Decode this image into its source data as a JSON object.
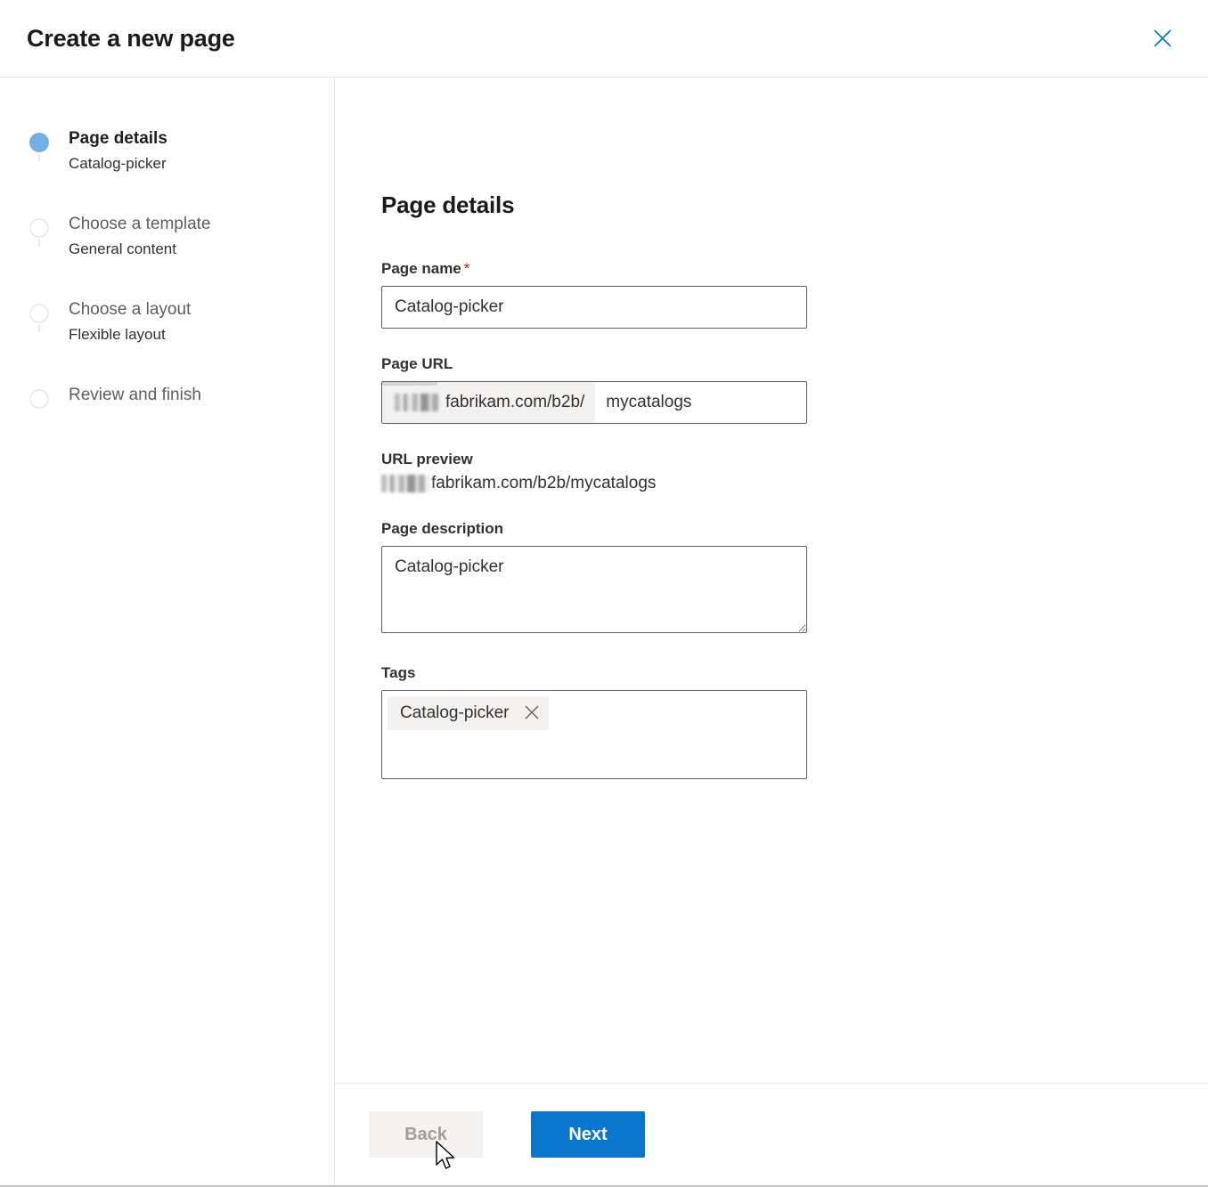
{
  "header": {
    "title": "Create a new page",
    "close_icon": "close-icon",
    "close_color": "#0b76cd"
  },
  "sidebar": {
    "steps": [
      {
        "title": "Page details",
        "sub": "Catalog-picker",
        "state": "current"
      },
      {
        "title": "Choose a template",
        "sub": "General content",
        "state": "pending"
      },
      {
        "title": "Choose a layout",
        "sub": "Flexible layout",
        "state": "pending"
      },
      {
        "title": "Review and finish",
        "sub": "",
        "state": "pending"
      }
    ],
    "active_dot_color": "#71afe5",
    "inactive_dot_color": "#edebe9"
  },
  "main": {
    "title": "Page details",
    "page_name": {
      "label": "Page name",
      "required_marker": "*",
      "value": "Catalog-picker",
      "placeholder": "Enter a page name"
    },
    "page_url": {
      "label": "Page URL",
      "prefix": "fabrikam.com/b2b/",
      "prefix_redacted": true,
      "value": "mycatalogs",
      "placeholder": ""
    },
    "url_preview": {
      "label": "URL preview",
      "value": "fabrikam.com/b2b/mycatalogs"
    },
    "page_description": {
      "label": "Page description",
      "value": "Catalog-picker",
      "placeholder": "Enter a page description"
    },
    "tags": {
      "label": "Tags",
      "chips": [
        {
          "text": "Catalog-picker",
          "remove_icon": "close-icon"
        }
      ],
      "placeholder": ""
    }
  },
  "footer": {
    "back_label": "Back",
    "back_disabled": true,
    "next_label": "Next",
    "next_color": "#0b76cd"
  },
  "cursor": {
    "icon": "mouse-pointer-icon"
  }
}
